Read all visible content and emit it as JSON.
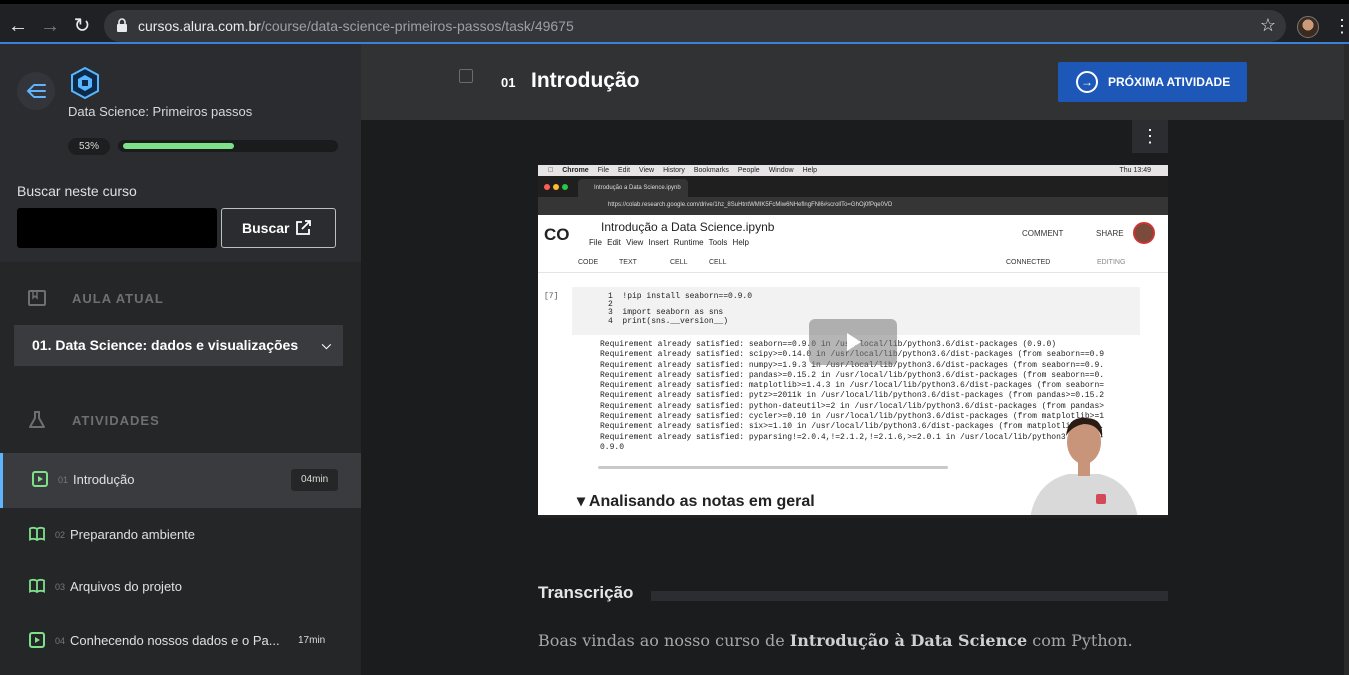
{
  "browser": {
    "url_host": "cursos.alura.com.br",
    "url_path": "/course/data-science-primeiros-passos/task/49675"
  },
  "sidebar": {
    "course_name": "Data Science: Primeiros passos",
    "progress_label": "53%",
    "progress_value": 0.53,
    "search_label": "Buscar neste curso",
    "search_value": "",
    "search_button": "Buscar",
    "current_section_label": "AULA ATUAL",
    "current_lesson": "01. Data Science: dados e visualizações",
    "activities_label": "ATIVIDADES",
    "activities": [
      {
        "num": "01",
        "title": "Introdução",
        "duration": "04min",
        "icon": "video-icon"
      },
      {
        "num": "02",
        "title": "Preparando ambiente",
        "duration": "",
        "icon": "book-icon"
      },
      {
        "num": "03",
        "title": "Arquivos do projeto",
        "duration": "",
        "icon": "book-icon"
      },
      {
        "num": "04",
        "title": "Conhecendo nossos dados e o Pa...",
        "duration": "17min",
        "icon": "video-icon"
      }
    ]
  },
  "main": {
    "activity_num": "01",
    "activity_title": "Introdução",
    "next_button": "PRÓXIMA ATIVIDADE",
    "transcript_title": "Transcrição",
    "transcript_pre": "Boas vindas ao nosso curso de ",
    "transcript_bold": "Introdução à Data Science",
    "transcript_post": " com Python."
  },
  "video": {
    "mac_menu": [
      "Chrome",
      "File",
      "Edit",
      "View",
      "History",
      "Bookmarks",
      "People",
      "Window",
      "Help"
    ],
    "mac_time": "Thu 13:49",
    "tab_title": "Introdução a Data Science.ipynb",
    "inner_url": "https://colab.research.google.com/drive/1hz_8SuHtntWMIK5FcMiw6NHeflngFNl6#scrollTo=GhOj0fPqe0VD",
    "notebook_title": "Introdução a Data Science.ipynb",
    "notebook_menu": "File Edit View Insert Runtime Tools Help",
    "comment": "COMMENT",
    "share": "SHARE",
    "tb_code": "CODE",
    "tb_text": "TEXT",
    "tb_cell_up": "CELL",
    "tb_cell_down": "CELL",
    "connected": "CONNECTED",
    "editing": "EDITING",
    "cell_counter": "[7]",
    "code_lines": [
      "1  !pip install seaborn==0.9.0",
      "2",
      "3  import seaborn as sns",
      "4  print(sns.__version__)"
    ],
    "output_lines": [
      "Requirement already satisfied: seaborn==0.9.0 in /usr/local/lib/python3.6/dist-packages (0.9.0)",
      "Requirement already satisfied: scipy>=0.14.0 in /usr/local/lib/python3.6/dist-packages (from seaborn==0.9",
      "Requirement already satisfied: numpy>=1.9.3 in /usr/local/lib/python3.6/dist-packages (from seaborn==0.9.",
      "Requirement already satisfied: pandas>=0.15.2 in /usr/local/lib/python3.6/dist-packages (from seaborn==0.",
      "Requirement already satisfied: matplotlib>=1.4.3 in /usr/local/lib/python3.6/dist-packages (from seaborn=",
      "Requirement already satisfied: pytz>=2011k in /usr/local/lib/python3.6/dist-packages (from pandas>=0.15.2",
      "Requirement already satisfied: python-dateutil>=2 in /usr/local/lib/python3.6/dist-packages (from pandas>",
      "Requirement already satisfied: cycler>=0.10 in /usr/local/lib/python3.6/dist-packages (from matplotlib>=1",
      "Requirement already satisfied: six>=1.10 in /usr/local/lib/python3.6/dist-packages (from matplotlib>=1.4.",
      "Requirement already satisfied: pyparsing!=2.0.4,!=2.1.2,!=2.1.6,>=2.0.1 in /usr/local/lib/python3.6/dist-",
      "0.9.0"
    ],
    "section_heading": "Analisando as notas em geral"
  },
  "colors": {
    "accent_blue": "#1d58b8",
    "progress_green": "#7fe08a",
    "icon_green": "#7fe08a"
  }
}
